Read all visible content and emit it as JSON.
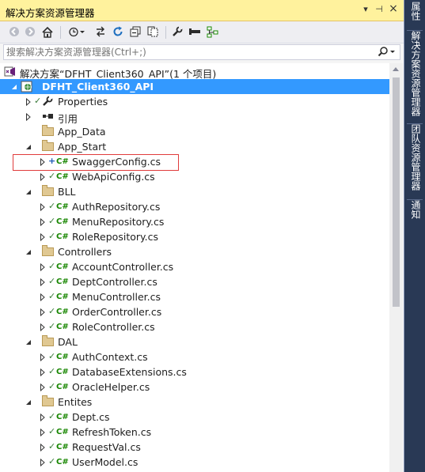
{
  "window": {
    "title": "解决方案资源管理器",
    "pin_glyph": "▾",
    "autohide_glyph": "⊣",
    "close_glyph": "×"
  },
  "search": {
    "placeholder": "搜索解决方案资源管理器(Ctrl+;)"
  },
  "tree": {
    "solution_label": "解决方案“DFHT_Client360_API”(1 个项目)",
    "project_label": "DFHT_Client360_API",
    "items": [
      {
        "label": "Properties",
        "kind": "properties",
        "depth": 1,
        "expander": "collapsed",
        "check": true
      },
      {
        "label": "引用",
        "kind": "references",
        "depth": 1,
        "expander": "collapsed",
        "check": false
      },
      {
        "label": "App_Data",
        "kind": "folder",
        "depth": 1,
        "expander": "none",
        "check": false
      },
      {
        "label": "App_Start",
        "kind": "folder",
        "depth": 1,
        "expander": "expanded",
        "check": false
      },
      {
        "label": "SwaggerConfig.cs",
        "kind": "cs",
        "depth": 2,
        "expander": "collapsed",
        "check": false,
        "added": true
      },
      {
        "label": "WebApiConfig.cs",
        "kind": "cs",
        "depth": 2,
        "expander": "collapsed",
        "check": true
      },
      {
        "label": "BLL",
        "kind": "folder",
        "depth": 1,
        "expander": "expanded",
        "check": false
      },
      {
        "label": "AuthRepository.cs",
        "kind": "cs",
        "depth": 2,
        "expander": "collapsed",
        "check": true
      },
      {
        "label": "MenuRepository.cs",
        "kind": "cs",
        "depth": 2,
        "expander": "collapsed",
        "check": true
      },
      {
        "label": "RoleRepository.cs",
        "kind": "cs",
        "depth": 2,
        "expander": "collapsed",
        "check": true
      },
      {
        "label": "Controllers",
        "kind": "folder",
        "depth": 1,
        "expander": "expanded",
        "check": false
      },
      {
        "label": "AccountController.cs",
        "kind": "cs",
        "depth": 2,
        "expander": "collapsed",
        "check": true
      },
      {
        "label": "DeptController.cs",
        "kind": "cs",
        "depth": 2,
        "expander": "collapsed",
        "check": true
      },
      {
        "label": "MenuController.cs",
        "kind": "cs",
        "depth": 2,
        "expander": "collapsed",
        "check": true
      },
      {
        "label": "OrderController.cs",
        "kind": "cs",
        "depth": 2,
        "expander": "collapsed",
        "check": true
      },
      {
        "label": "RoleController.cs",
        "kind": "cs",
        "depth": 2,
        "expander": "collapsed",
        "check": true
      },
      {
        "label": "DAL",
        "kind": "folder",
        "depth": 1,
        "expander": "expanded",
        "check": false
      },
      {
        "label": "AuthContext.cs",
        "kind": "cs",
        "depth": 2,
        "expander": "collapsed",
        "check": true
      },
      {
        "label": "DatabaseExtensions.cs",
        "kind": "cs",
        "depth": 2,
        "expander": "collapsed",
        "check": true
      },
      {
        "label": "OracleHelper.cs",
        "kind": "cs",
        "depth": 2,
        "expander": "collapsed",
        "check": true
      },
      {
        "label": "Entites",
        "kind": "folder",
        "depth": 1,
        "expander": "expanded",
        "check": false
      },
      {
        "label": "Dept.cs",
        "kind": "cs",
        "depth": 2,
        "expander": "collapsed",
        "check": true
      },
      {
        "label": "RefreshToken.cs",
        "kind": "cs",
        "depth": 2,
        "expander": "collapsed",
        "check": true
      },
      {
        "label": "RequestVal.cs",
        "kind": "cs",
        "depth": 2,
        "expander": "collapsed",
        "check": true
      },
      {
        "label": "UserModel.cs",
        "kind": "cs",
        "depth": 2,
        "expander": "collapsed",
        "check": true
      }
    ]
  },
  "cs_badge": "C#",
  "side_tabs": [
    "属性",
    "解决方案资源管理器",
    "团队资源管理器",
    "通知"
  ],
  "colors": {
    "title_bg": "#fff29d",
    "selection": "#3399ff",
    "highlight_box": "#e03c3c",
    "side_bg": "#293955"
  }
}
